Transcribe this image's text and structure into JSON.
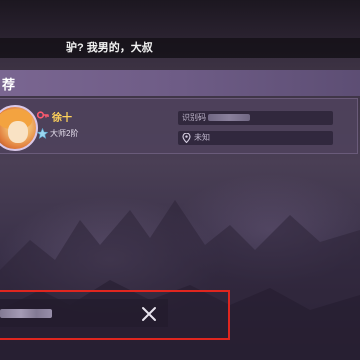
{
  "subtitle": {
    "text": "驴? 我男的，大叔"
  },
  "panel": {
    "title": "荐"
  },
  "player": {
    "name": "徐十",
    "rank": "大师2阶",
    "id_label": "识别码",
    "location": "未知"
  },
  "icons": {
    "key": "key-icon",
    "rank": "rank-icon",
    "pin": "location-pin-icon",
    "close": "close-icon"
  },
  "colors": {
    "accent_red": "#e0261f",
    "name_gold": "#ffd25a",
    "header_purple": "#7a6691"
  }
}
